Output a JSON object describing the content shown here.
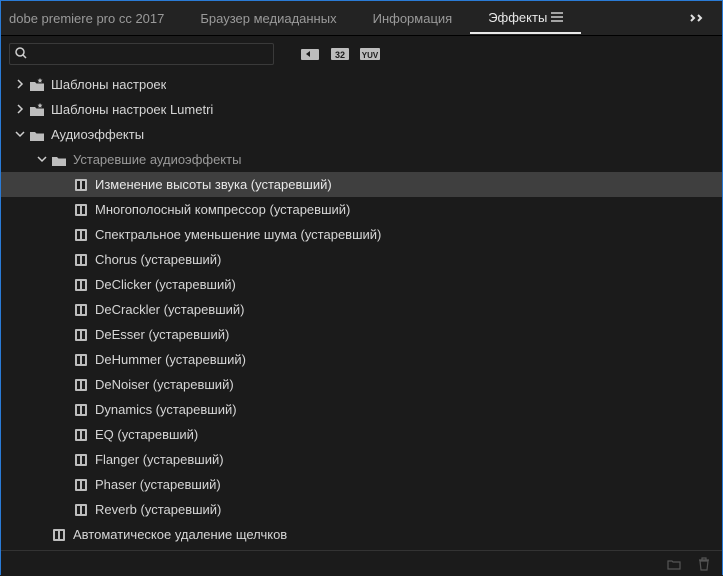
{
  "tabs": [
    {
      "label": "dobe premiere pro cc 2017",
      "active": false
    },
    {
      "label": "Браузер медиаданных",
      "active": false
    },
    {
      "label": "Информация",
      "active": false
    },
    {
      "label": "Эффекты",
      "active": true
    }
  ],
  "search": {
    "value": "",
    "placeholder": ""
  },
  "toggles": [
    "accelerated-effects-icon",
    "32-bit-icon",
    "yuv-icon"
  ],
  "tree": [
    {
      "depth": 0,
      "kind": "bin-star",
      "twisty": "closed",
      "label": "Шаблоны настроек",
      "selected": false
    },
    {
      "depth": 0,
      "kind": "bin-star",
      "twisty": "closed",
      "label": "Шаблоны настроек Lumetri",
      "selected": false
    },
    {
      "depth": 0,
      "kind": "bin",
      "twisty": "open",
      "label": "Аудиоэффекты",
      "selected": false
    },
    {
      "depth": 1,
      "kind": "bin",
      "twisty": "open",
      "label": "Устаревшие аудиоэффекты",
      "selected": false,
      "subtle": true
    },
    {
      "depth": 2,
      "kind": "fx",
      "twisty": "none",
      "label": "Изменение высоты звука (устаревший)",
      "selected": true
    },
    {
      "depth": 2,
      "kind": "fx",
      "twisty": "none",
      "label": "Многополосный компрессор (устаревший)",
      "selected": false
    },
    {
      "depth": 2,
      "kind": "fx",
      "twisty": "none",
      "label": "Спектральное уменьшение шума (устаревший)",
      "selected": false
    },
    {
      "depth": 2,
      "kind": "fx",
      "twisty": "none",
      "label": "Chorus (устаревший)",
      "selected": false
    },
    {
      "depth": 2,
      "kind": "fx",
      "twisty": "none",
      "label": "DeClicker (устаревший)",
      "selected": false
    },
    {
      "depth": 2,
      "kind": "fx",
      "twisty": "none",
      "label": "DeCrackler (устаревший)",
      "selected": false
    },
    {
      "depth": 2,
      "kind": "fx",
      "twisty": "none",
      "label": "DeEsser (устаревший)",
      "selected": false
    },
    {
      "depth": 2,
      "kind": "fx",
      "twisty": "none",
      "label": "DeHummer (устаревший)",
      "selected": false
    },
    {
      "depth": 2,
      "kind": "fx",
      "twisty": "none",
      "label": "DeNoiser (устаревший)",
      "selected": false
    },
    {
      "depth": 2,
      "kind": "fx",
      "twisty": "none",
      "label": "Dynamics (устаревший)",
      "selected": false
    },
    {
      "depth": 2,
      "kind": "fx",
      "twisty": "none",
      "label": "EQ (устаревший)",
      "selected": false
    },
    {
      "depth": 2,
      "kind": "fx",
      "twisty": "none",
      "label": "Flanger (устаревший)",
      "selected": false
    },
    {
      "depth": 2,
      "kind": "fx",
      "twisty": "none",
      "label": "Phaser (устаревший)",
      "selected": false
    },
    {
      "depth": 2,
      "kind": "fx",
      "twisty": "none",
      "label": "Reverb (устаревший)",
      "selected": false
    },
    {
      "depth": 1,
      "kind": "fx",
      "twisty": "none",
      "label": "Автоматическое удаление щелчков",
      "selected": false
    }
  ]
}
